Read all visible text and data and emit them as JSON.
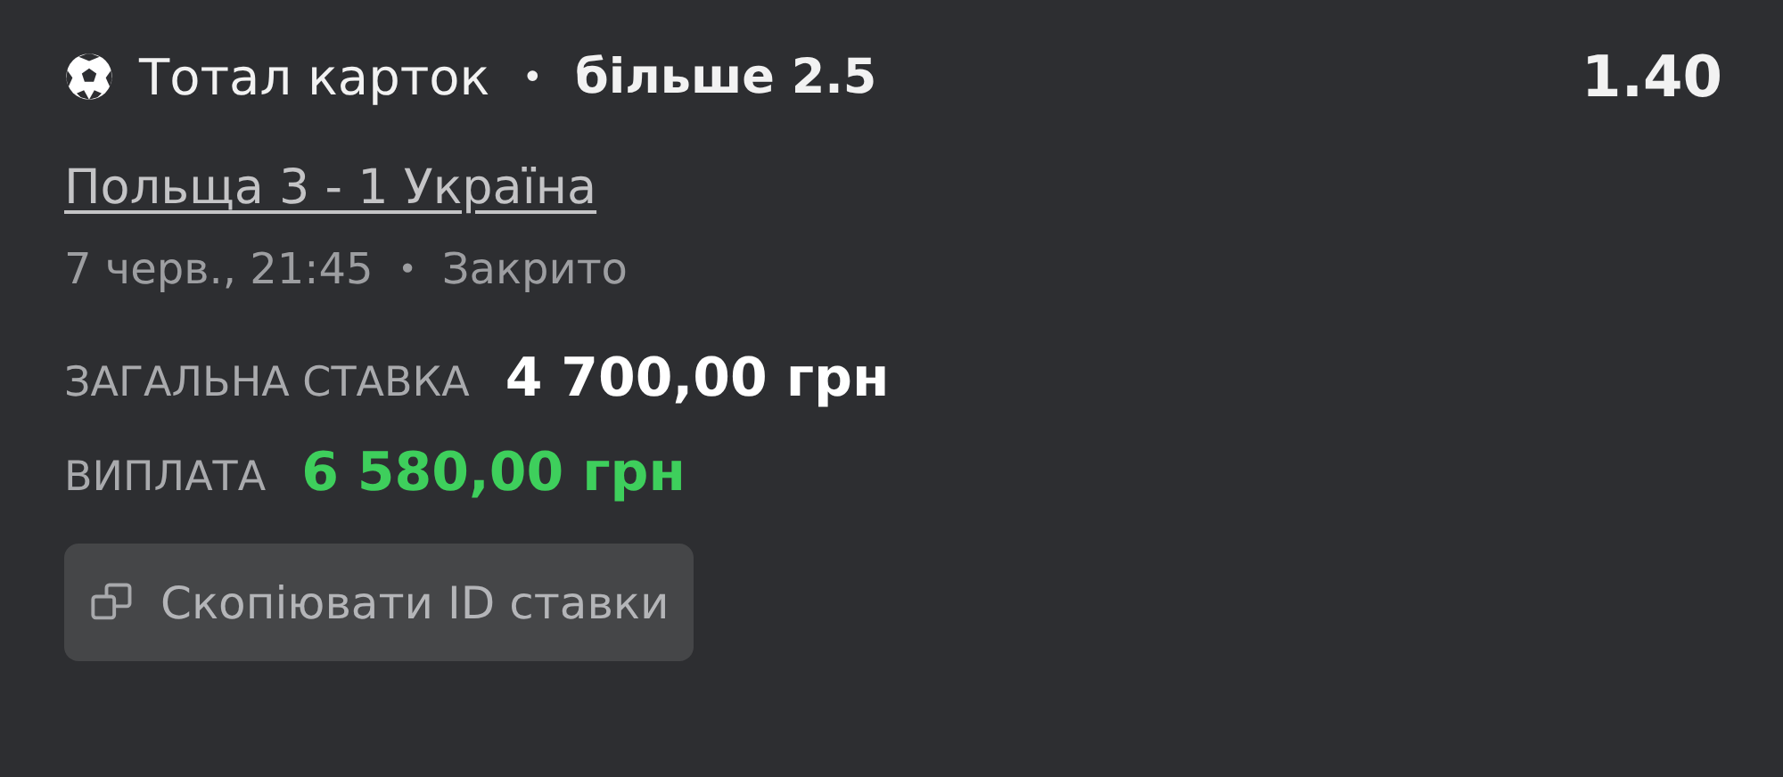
{
  "bet": {
    "market": "Тотал карток",
    "separator": "•",
    "selection": "більше 2.5",
    "odds": "1.40"
  },
  "match": {
    "title": "Польща 3 - 1 Україна",
    "date": "7 черв., 21:45",
    "separator": "•",
    "status": "Закрито"
  },
  "amounts": [
    {
      "kind": "stake",
      "label": "ЗАГАЛЬНА СТАВКА",
      "value": "4 700,00 грн"
    },
    {
      "kind": "payout",
      "label": "ВИПЛАТА",
      "value": "6 580,00 грн"
    }
  ],
  "copy_button": {
    "label": "Скопіювати ID ставки"
  }
}
